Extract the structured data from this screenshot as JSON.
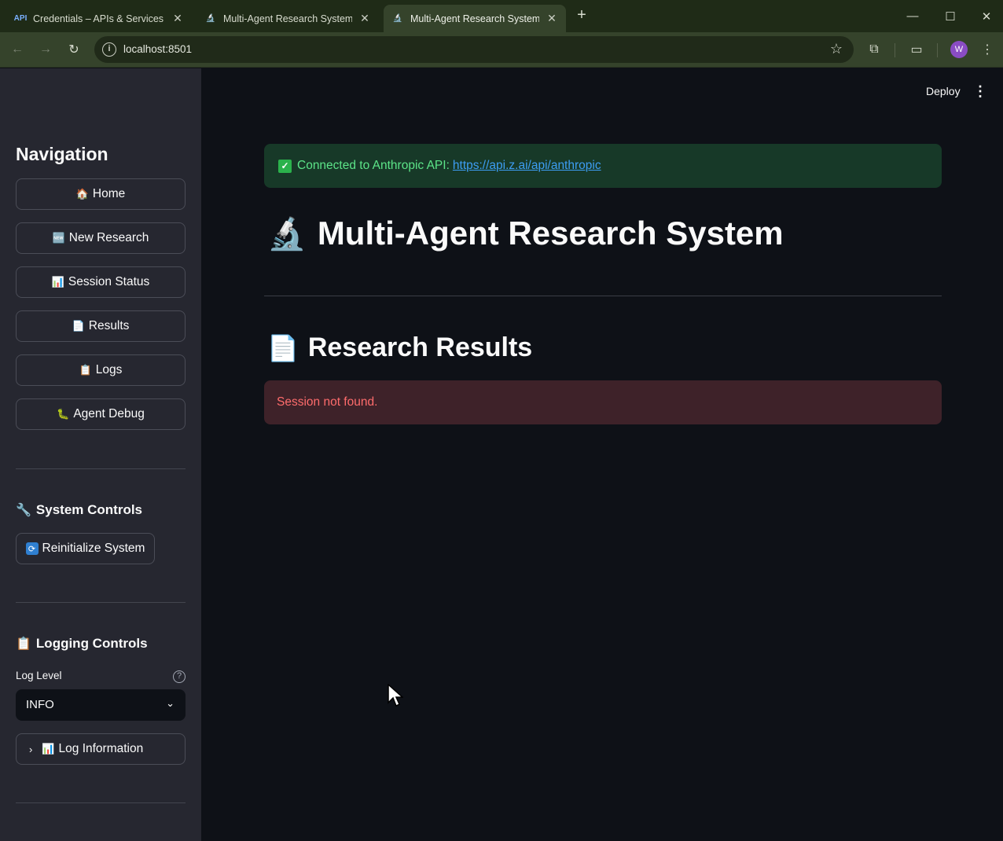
{
  "browser": {
    "tabs": [
      {
        "favicon": "API",
        "title": "Credentials – APIs & Services – ..."
      },
      {
        "favicon": "microscope-icon",
        "title": "Multi-Agent Research System"
      },
      {
        "favicon": "microscope-icon",
        "title": "Multi-Agent Research System"
      }
    ],
    "url": "localhost:8501",
    "profile_initial": "W"
  },
  "sidebar": {
    "nav_title": "Navigation",
    "buttons": [
      {
        "icon": "🏠",
        "label": "Home"
      },
      {
        "icon": "🆕",
        "label": "New Research"
      },
      {
        "icon": "📊",
        "label": "Session Status"
      },
      {
        "icon": "📄",
        "label": "Results"
      },
      {
        "icon": "📋",
        "label": "Logs"
      },
      {
        "icon": "🐛",
        "label": "Agent Debug"
      }
    ],
    "system_controls": {
      "icon": "🔧",
      "title": "System Controls",
      "reinit_icon": "🔄",
      "reinit_label": "Reinitialize System"
    },
    "logging_controls": {
      "icon": "📋",
      "title": "Logging Controls",
      "log_level_label": "Log Level",
      "log_level_value": "INFO",
      "expander_icon": "📊",
      "expander_label": "Log Information"
    }
  },
  "main": {
    "deploy_label": "Deploy",
    "success": {
      "text": "Connected to Anthropic API:",
      "link": "https://api.z.ai/api/anthropic"
    },
    "title_icon": "🔬",
    "title": "Multi-Agent Research System",
    "section_icon": "📄",
    "section_title": "Research Results",
    "error": "Session not found."
  },
  "colors": {
    "accent_link": "#3d9df3",
    "success_text": "#5ce488",
    "error_text": "#ff6c6c",
    "sidebar_bg": "#262730",
    "main_bg": "#0e1117"
  }
}
